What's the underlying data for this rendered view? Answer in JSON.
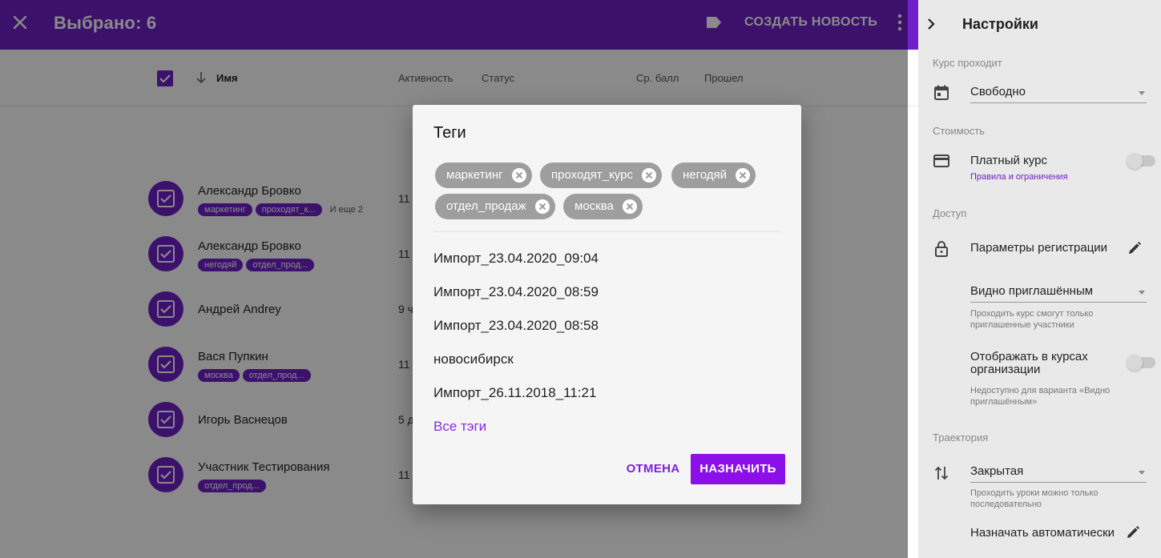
{
  "topbar": {
    "title": "Выбрано: 6",
    "create_label": "СОЗДАТЬ НОВОСТЬ"
  },
  "columns": {
    "name": "Имя",
    "activity": "Активность",
    "status": "Статус",
    "avg": "Ср. балл",
    "passed": "Прошел"
  },
  "rows": [
    {
      "name": "Александр Бровко",
      "tags": [
        "маркетинг",
        "проходят_к..."
      ],
      "more": "И еще 2",
      "activity": "11"
    },
    {
      "name": "Александр Бровко",
      "tags": [
        "негодяй",
        "отдел_прод..."
      ],
      "more": "",
      "activity": "11"
    },
    {
      "name": "Андрей Andrey",
      "tags": [],
      "more": "",
      "activity": "9 ч"
    },
    {
      "name": "Вася Пупкин",
      "tags": [
        "москва",
        "отдел_прод..."
      ],
      "more": "",
      "activity": "11"
    },
    {
      "name": "Игорь Васнецов",
      "tags": [],
      "more": "",
      "activity": "5 д"
    },
    {
      "name": "Участник Тестирования",
      "tags": [
        "отдел_прод..."
      ],
      "more": "",
      "activity": "11"
    }
  ],
  "settings": {
    "title": "Настройки",
    "course_runs_label": "Курс проходит",
    "course_runs_value": "Свободно",
    "cost_label": "Стоимость",
    "paid_course": "Платный курс",
    "rules_link": "Правила и ограничения",
    "access_label": "Доступ",
    "registration_params": "Параметры регистрации",
    "visibility_value": "Видно приглашённым",
    "visibility_hint": "Проходить курс смогут только приглашенные участники",
    "show_in_org": "Отображать в курсах организации",
    "show_in_org_hint": "Недоступно для варианта «Видно приглашённым»",
    "trajectory_label": "Траектория",
    "trajectory_value": "Закрытая",
    "trajectory_hint": "Проходить уроки можно только последовательно",
    "assign_auto": "Назначать автоматически"
  },
  "dialog": {
    "title": "Теги",
    "chips": [
      "маркетинг",
      "проходят_курс",
      "негодяй",
      "отдел_продаж",
      "москва"
    ],
    "options": [
      "Импорт_23.04.2020_09:04",
      "Импорт_23.04.2020_08:59",
      "Импорт_23.04.2020_08:58",
      "новосибирск",
      "Импорт_26.11.2018_11:21"
    ],
    "all_tags": "Все тэги",
    "cancel": "ОТМЕНА",
    "assign": "НАЗНАЧИТЬ"
  },
  "colors": {
    "primary": "#6f20c8",
    "accent": "#8a0fe8",
    "chip": "#9e9e9e"
  }
}
